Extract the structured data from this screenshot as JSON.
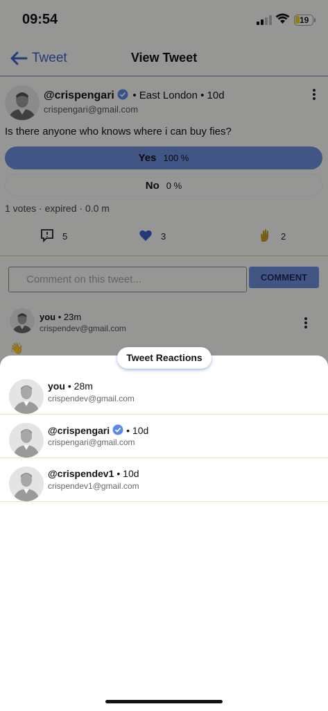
{
  "status_bar": {
    "time": "09:54",
    "battery": "19"
  },
  "header": {
    "back_label": "Tweet",
    "title": "View Tweet"
  },
  "post": {
    "handle": "@crispengari",
    "meta": "• East London • 10d",
    "email": "crispengari@gmail.com",
    "text": "Is there anyone who knows where i can buy fies?",
    "poll": [
      {
        "label": "Yes",
        "percent": "100 %",
        "share": 1.0
      },
      {
        "label": "No",
        "percent": "0 %",
        "share": 0.0
      }
    ],
    "poll_summary": "1 votes · expired · 0.0 m",
    "actions": {
      "comments": "5",
      "likes": "3",
      "claps": "2"
    }
  },
  "comment_input": {
    "placeholder": "Comment on this tweet...",
    "button_label": "COMMENT"
  },
  "comment": {
    "handle": "you",
    "time": "• 23m",
    "email": "crispendev@gmail.com",
    "emoji": "👋"
  },
  "reactions_sheet": {
    "title": "Tweet Reactions",
    "items": [
      {
        "handle": "you",
        "time": "• 28m",
        "email": "crispendev@gmail.com",
        "verified": false
      },
      {
        "handle": "@crispengari",
        "time": "• 10d",
        "email": "crispengari@gmail.com",
        "verified": true
      },
      {
        "handle": "@crispendev1",
        "time": "• 10d",
        "email": "crispendev1@gmail.com",
        "verified": false
      }
    ]
  },
  "colors": {
    "accent": "#6f90e0",
    "link": "#3a63c9",
    "verified": "#5b8be6",
    "divider": "#f2e6b8"
  }
}
